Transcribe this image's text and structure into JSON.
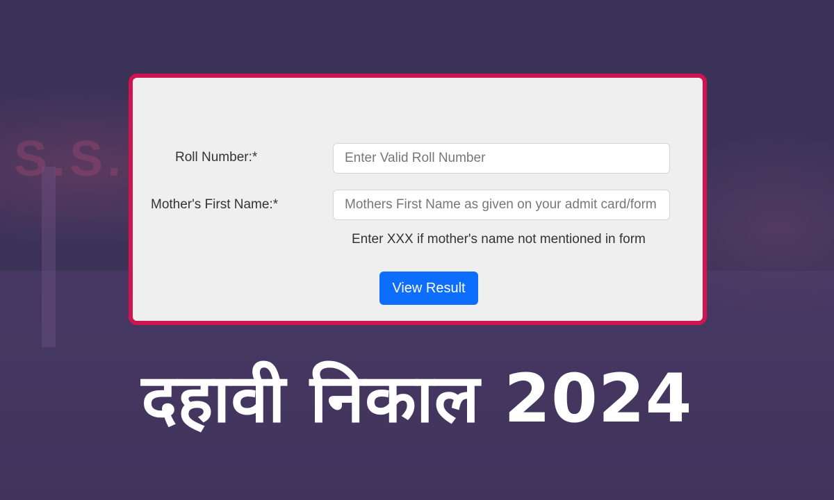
{
  "background": {
    "watermark_text": "S.S."
  },
  "form": {
    "roll_number_label": "Roll Number:*",
    "roll_number_placeholder": "Enter Valid Roll Number",
    "mother_name_label": "Mother's First Name:*",
    "mother_name_placeholder": "Mothers First Name as given on your admit card/form",
    "mother_name_hint": "Enter XXX if mother's name not mentioned in form",
    "submit_label": "View Result"
  },
  "headline": "दहावी निकाल 2024",
  "colors": {
    "card_border": "#cf1450",
    "button": "#0d6efd",
    "background": "#3b3158"
  }
}
